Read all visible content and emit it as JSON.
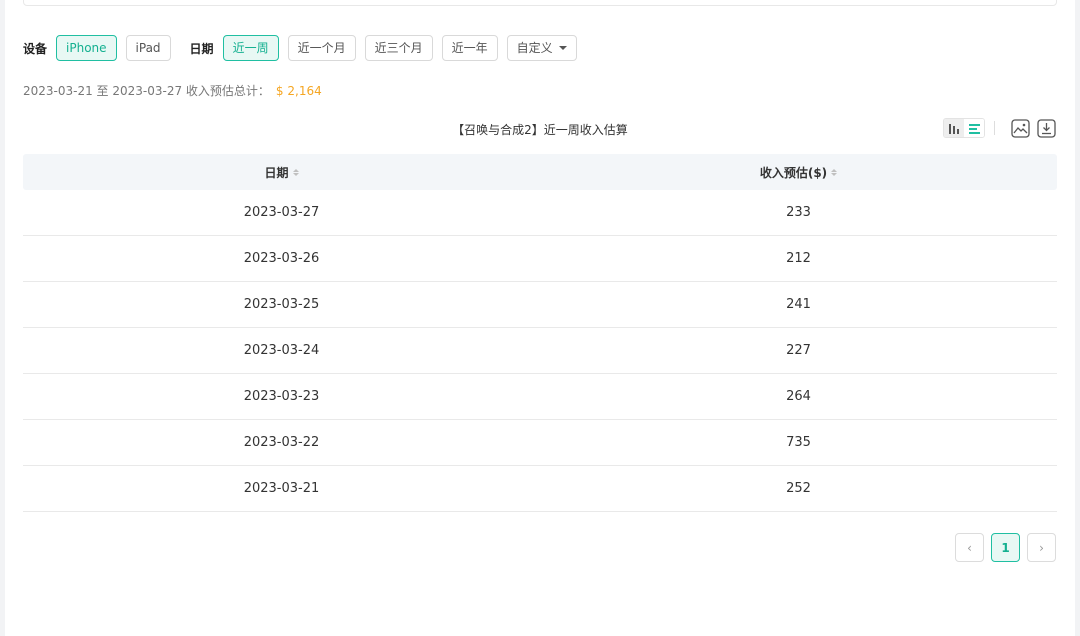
{
  "filters": {
    "device_label": "设备",
    "devices": [
      "iPhone",
      "iPad"
    ],
    "date_label": "日期",
    "ranges": [
      "近一周",
      "近一个月",
      "近三个月",
      "近一年"
    ],
    "custom": "自定义"
  },
  "summary": {
    "text": "2023-03-21 至 2023-03-27 收入预估总计：",
    "total": "$ 2,164"
  },
  "table": {
    "title": "【召唤与合成2】近一周收入估算",
    "headers": [
      "日期",
      "收入预估($)"
    ],
    "rows": [
      [
        "2023-03-27",
        "233"
      ],
      [
        "2023-03-26",
        "212"
      ],
      [
        "2023-03-25",
        "241"
      ],
      [
        "2023-03-24",
        "227"
      ],
      [
        "2023-03-23",
        "264"
      ],
      [
        "2023-03-22",
        "735"
      ],
      [
        "2023-03-21",
        "252"
      ]
    ]
  },
  "pagination": {
    "prev": "‹",
    "current": "1",
    "next": "›"
  },
  "icons": {
    "bar_view": "bar-chart-icon",
    "list_view": "list-icon",
    "image": "image-icon",
    "download": "download-icon"
  },
  "colors": {
    "accent": "#20bfa2",
    "total": "#f5a623"
  }
}
